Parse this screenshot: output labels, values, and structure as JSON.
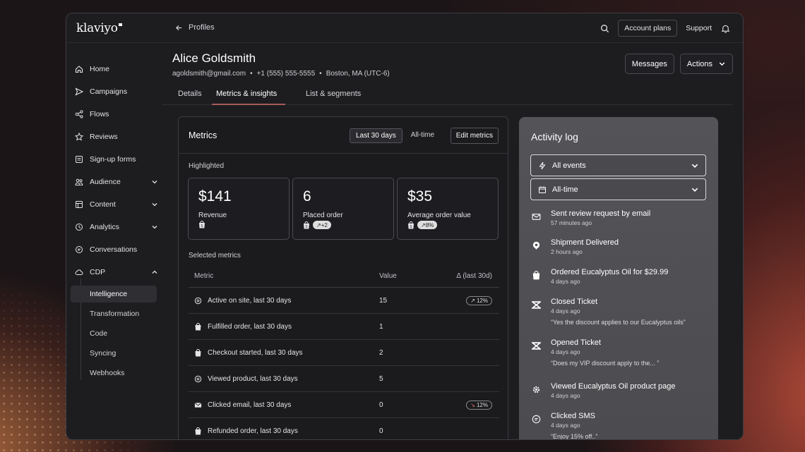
{
  "app": {
    "logo": "klaviyo"
  },
  "topbar": {
    "back_label": "Profiles",
    "account_plans": "Account plans",
    "support": "Support"
  },
  "sidebar": {
    "items": [
      {
        "label": "Home",
        "icon": "home-icon"
      },
      {
        "label": "Campaigns",
        "icon": "send-icon"
      },
      {
        "label": "Flows",
        "icon": "flows-icon"
      },
      {
        "label": "Reviews",
        "icon": "star-icon"
      },
      {
        "label": "Sign-up forms",
        "icon": "form-icon"
      },
      {
        "label": "Audience",
        "icon": "people-icon"
      },
      {
        "label": "Content",
        "icon": "content-icon"
      },
      {
        "label": "Analytics",
        "icon": "analytics-icon"
      },
      {
        "label": "Conversations",
        "icon": "chat-icon"
      },
      {
        "label": "CDP",
        "icon": "cloud-icon"
      }
    ],
    "cdp_sub": [
      "Intelligence",
      "Transformation",
      "Code",
      "Syncing",
      "Webhooks"
    ]
  },
  "profile": {
    "name": "Alice Goldsmith",
    "email": "agoldsmith@gmail.com",
    "phone": "+1 (555) 555-5555",
    "location": "Boston, MA (UTC-6)",
    "sep": "•"
  },
  "header_buttons": {
    "messages": "Messages",
    "actions": "Actions"
  },
  "tabs": [
    "Details",
    "Metrics & insights",
    "List & segments"
  ],
  "metrics": {
    "title": "Metrics",
    "range_options": [
      "Last 30 days",
      "All-time"
    ],
    "edit": "Edit metrics",
    "highlighted_label": "Highlighted",
    "cards": [
      {
        "value": "$141",
        "label": "Revenue",
        "pill": ""
      },
      {
        "value": "6",
        "label": "Placed order",
        "pill": "+2"
      },
      {
        "value": "$35",
        "label": "Average order value",
        "pill": "8%"
      }
    ],
    "selected_label": "Selected metrics",
    "columns": [
      "Metric",
      "Value",
      "Δ (last 30d)"
    ],
    "rows": [
      {
        "icon": "gear-icon",
        "metric": "Active on site, last 30 days",
        "value": "15",
        "delta": "12%",
        "dir": "up"
      },
      {
        "icon": "shopify-bag-icon",
        "metric": "Fulfilled order, last 30 days",
        "value": "1",
        "delta": "",
        "dir": ""
      },
      {
        "icon": "shopify-bag-icon",
        "metric": "Checkout started, last 30 days",
        "value": "2",
        "delta": "",
        "dir": ""
      },
      {
        "icon": "gear-icon",
        "metric": "Viewed product, last 30 days",
        "value": "5",
        "delta": "",
        "dir": ""
      },
      {
        "icon": "email-icon",
        "metric": "Clicked email, last 30 days",
        "value": "0",
        "delta": "12%",
        "dir": "down"
      },
      {
        "icon": "shopify-bag-icon",
        "metric": "Refunded order, last 30 days",
        "value": "0",
        "delta": "",
        "dir": ""
      }
    ]
  },
  "activity": {
    "title": "Activity log",
    "filter_events": "All events",
    "filter_time": "All-time",
    "events": [
      {
        "icon": "email-icon",
        "title": "Sent review request by email",
        "time": "57 minutes ago",
        "quote": ""
      },
      {
        "icon": "location-icon",
        "title": "Shipment Delivered",
        "time": "2 hours ago",
        "quote": ""
      },
      {
        "icon": "shopify-bag-icon",
        "title": "Ordered Eucalyptus Oil for $29.99",
        "time": "4 days ago",
        "quote": ""
      },
      {
        "icon": "zendesk-icon",
        "title": "Closed Ticket",
        "time": "4 days ago",
        "quote": "“Yes the discount applies to our Eucalyptus oils”"
      },
      {
        "icon": "zendesk-icon",
        "title": "Opened Ticket",
        "time": "4 days ago",
        "quote": "“Does my VIP discount apply to the... ”"
      },
      {
        "icon": "gear-icon",
        "title": "Viewed Eucalyptus Oil product page",
        "time": "4 days ago",
        "quote": ""
      },
      {
        "icon": "sms-icon",
        "title": "Clicked SMS",
        "time": "4 days ago",
        "quote": "“Enjoy 15% off..”"
      }
    ]
  }
}
